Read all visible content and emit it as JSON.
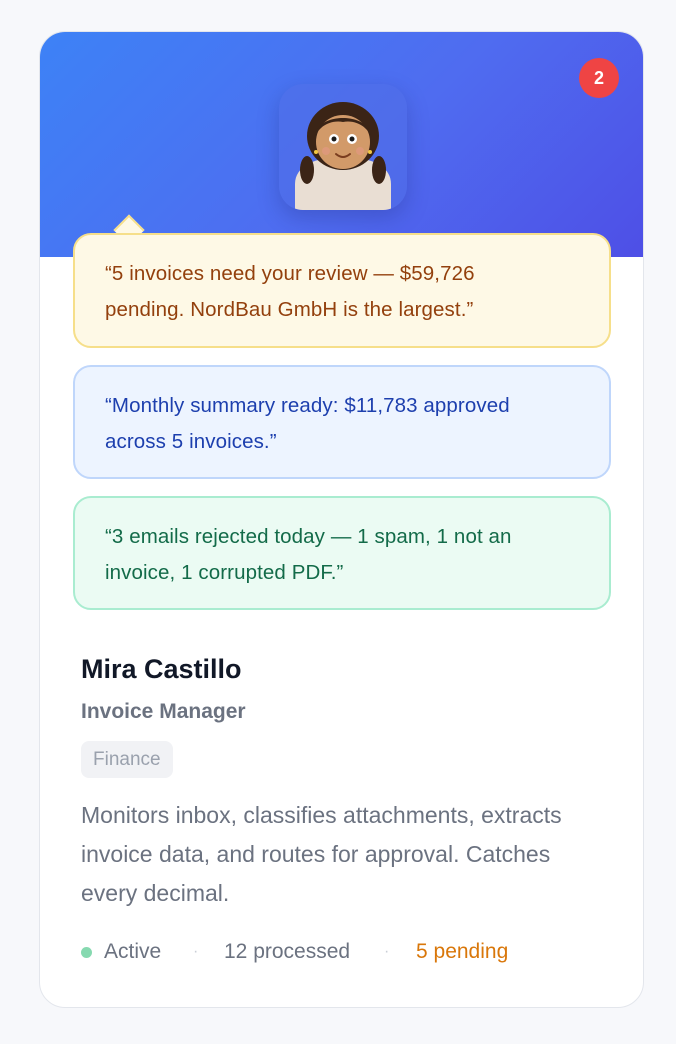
{
  "notification_count": "2",
  "messages": [
    {
      "text": "“5 invoices need your review — $59,726 pending. NordBau GmbH is the largest.”"
    },
    {
      "text": "“Monthly summary ready: $11,783 approved across 5 invoices.”"
    },
    {
      "text": "“3 emails rejected today — 1 spam, 1 not an invoice, 1 corrupted PDF.”"
    }
  ],
  "profile": {
    "name": "Mira Castillo",
    "role": "Invoice Manager",
    "department": "Finance",
    "description": "Monitors inbox, classifies attachments, extracts invoice data, and routes for approval. Catches every decimal."
  },
  "stats": {
    "status": "Active",
    "separator": "·",
    "processed": "12 processed",
    "pending": "5 pending"
  },
  "colors": {
    "header_gradient_start": "#3d82f6",
    "header_gradient_end": "#4e4fe6",
    "badge": "#ef4444",
    "status_active": "#86d9b0",
    "pending": "#d9770a"
  }
}
